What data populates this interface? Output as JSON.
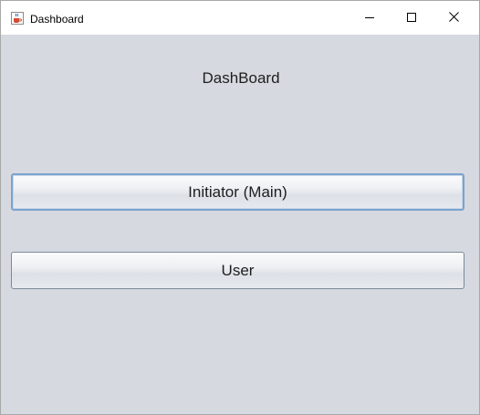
{
  "window": {
    "title": "Dashboard",
    "icon": "java-coffee-cup-icon",
    "controls": {
      "minimize": "minimize-icon",
      "maximize": "maximize-icon",
      "close": "close-icon"
    }
  },
  "main": {
    "heading": "DashBoard",
    "buttons": [
      {
        "label": "Initiator (Main)",
        "focused": true
      },
      {
        "label": "User",
        "focused": false
      }
    ]
  },
  "colors": {
    "background": "#d6d9e0",
    "titlebar": "#ffffff",
    "focus_border": "#7da2ce"
  }
}
